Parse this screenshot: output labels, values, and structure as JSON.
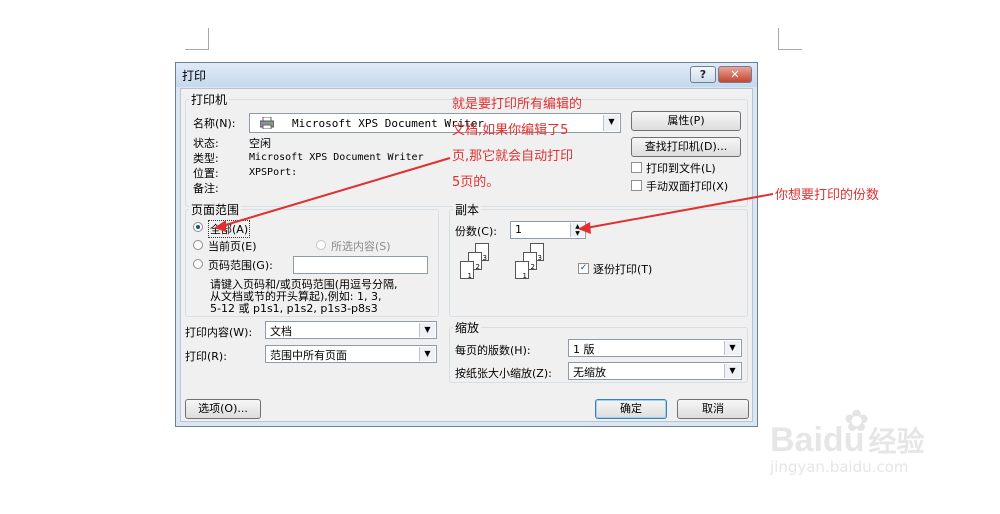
{
  "dialog": {
    "title": "打印",
    "help_label": "?",
    "close_label": "✕",
    "printer_group": {
      "title": "打印机",
      "name_label": "名称(N):",
      "name_value": "Microsoft XPS Document Writer",
      "status_label": "状态:",
      "status_value": "空闲",
      "type_label": "类型:",
      "type_value": "Microsoft XPS Document Writer",
      "where_label": "位置:",
      "where_value": "XPSPort:",
      "comment_label": "备注:",
      "properties_button": "属性(P)",
      "find_printer_button": "查找打印机(D)...",
      "print_to_file_label": "打印到文件(L)",
      "manual_duplex_label": "手动双面打印(X)"
    },
    "page_range": {
      "title": "页面范围",
      "all_label": "全部(A)",
      "current_label": "当前页(E)",
      "selection_label": "所选内容(S)",
      "pages_label": "页码范围(G):",
      "pages_value": "",
      "hint_line1": "请键入页码和/或页码范围(用逗号分隔,",
      "hint_line2": "从文档或节的开头算起),例如: 1, 3,",
      "hint_line3": "5-12 或 p1s1, p1s2, p1s3-p8s3"
    },
    "copies": {
      "title": "副本",
      "copies_label": "份数(C):",
      "copies_value": "1",
      "collate_label": "逐份打印(T)",
      "collate_checked": true,
      "page_numbers": [
        "3",
        "2",
        "1",
        "3",
        "2",
        "1"
      ]
    },
    "print_what_label": "打印内容(W):",
    "print_what_value": "文档",
    "print_label": "打印(R):",
    "print_value": "范围中所有页面",
    "zoom": {
      "title": "缩放",
      "pages_per_sheet_label": "每页的版数(H):",
      "pages_per_sheet_value": "1 版",
      "scale_label": "按纸张大小缩放(Z):",
      "scale_value": "无缩放"
    },
    "options_button": "选项(O)...",
    "ok_button": "确定",
    "cancel_button": "取消"
  },
  "annotations": {
    "note_line1": "就是要打印所有编辑的",
    "note_line2": "文档,如果你编辑了5",
    "note_line3": "页,那它就会自动打印",
    "note_line4": "5页的。",
    "copies_note": "你想要打印的份数",
    "color": "#e03030"
  },
  "watermark": {
    "brand": "Bai",
    "brand_tail": "du",
    "cn": "经验",
    "url": "jingyan.baidu.com"
  }
}
